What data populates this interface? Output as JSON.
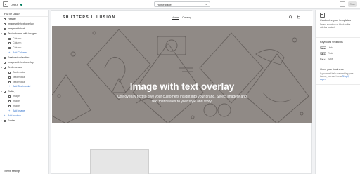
{
  "topbar": {
    "app_label": "Debut",
    "page_select": "Home page",
    "save_label": "Save"
  },
  "sidebar": {
    "title": "Home page",
    "items": [
      {
        "label": "Header",
        "level": 0,
        "icon": "header-icon"
      },
      {
        "label": "Image with text overlay",
        "level": 0,
        "icon": "image-overlay-icon"
      },
      {
        "label": "Image with text",
        "level": 0,
        "icon": "image-text-icon"
      },
      {
        "label": "Text columns with images",
        "level": 0,
        "icon": "columns-icon",
        "toggle": "▾"
      },
      {
        "label": "Column",
        "level": 1,
        "icon": "column-icon"
      },
      {
        "label": "Column",
        "level": 1,
        "icon": "column-icon"
      },
      {
        "label": "Column",
        "level": 1,
        "icon": "column-icon"
      },
      {
        "label": "Add Column",
        "level": 1,
        "add": true
      },
      {
        "label": "Featured collection",
        "level": 0,
        "icon": "collection-icon"
      },
      {
        "label": "Image with text overlay",
        "level": 0,
        "icon": "image-overlay-icon"
      },
      {
        "label": "Testimonials",
        "level": 0,
        "icon": "quote-icon",
        "toggle": "▾"
      },
      {
        "label": "Testimonial",
        "level": 1,
        "icon": "testimonial-icon"
      },
      {
        "label": "Testimonial",
        "level": 1,
        "icon": "testimonial-icon"
      },
      {
        "label": "Testimonial",
        "level": 1,
        "icon": "testimonial-icon"
      },
      {
        "label": "Add Testimonial",
        "level": 1,
        "add": true
      },
      {
        "label": "Gallery",
        "level": 0,
        "icon": "gallery-icon",
        "toggle": "▾"
      },
      {
        "label": "Image",
        "level": 1,
        "icon": "image-icon"
      },
      {
        "label": "Image",
        "level": 1,
        "icon": "image-icon"
      },
      {
        "label": "Image",
        "level": 1,
        "icon": "image-icon"
      },
      {
        "label": "Add Image",
        "level": 1,
        "add": true
      },
      {
        "label": "Add section",
        "level": 0,
        "add": true
      },
      {
        "label": "Footer",
        "level": 0,
        "icon": "footer-icon",
        "toggle": "▸"
      }
    ],
    "theme_settings": "Theme settings"
  },
  "store": {
    "logo": "SHUTTERS ILLUSION",
    "nav": [
      "Home",
      "Catalog"
    ],
    "hero_title": "Image with text overlay",
    "hero_subtitle": "Use overlay text to give your customers insight into your brand. Select imagery and text that relates to your style and story."
  },
  "rpanel": {
    "customize_title": "Customize your templates",
    "customize_text": "Select a section or block in the sidebar to start.",
    "shortcuts_title": "Keyboard shortcuts",
    "shortcuts": [
      {
        "key": "⌘ Z",
        "label": "Undo"
      },
      {
        "key": "⌘ Y",
        "label": "Redo"
      },
      {
        "key": "⌘ S",
        "label": "Save"
      }
    ],
    "business_title": "Grow your business",
    "business_text": "If you need help customizing your theme, you can hire a",
    "business_link": "Shopify expert"
  },
  "colors": {
    "hero_bg": "#908a86",
    "accent_link": "#2c6ecb",
    "status_green": "#007f5f"
  }
}
